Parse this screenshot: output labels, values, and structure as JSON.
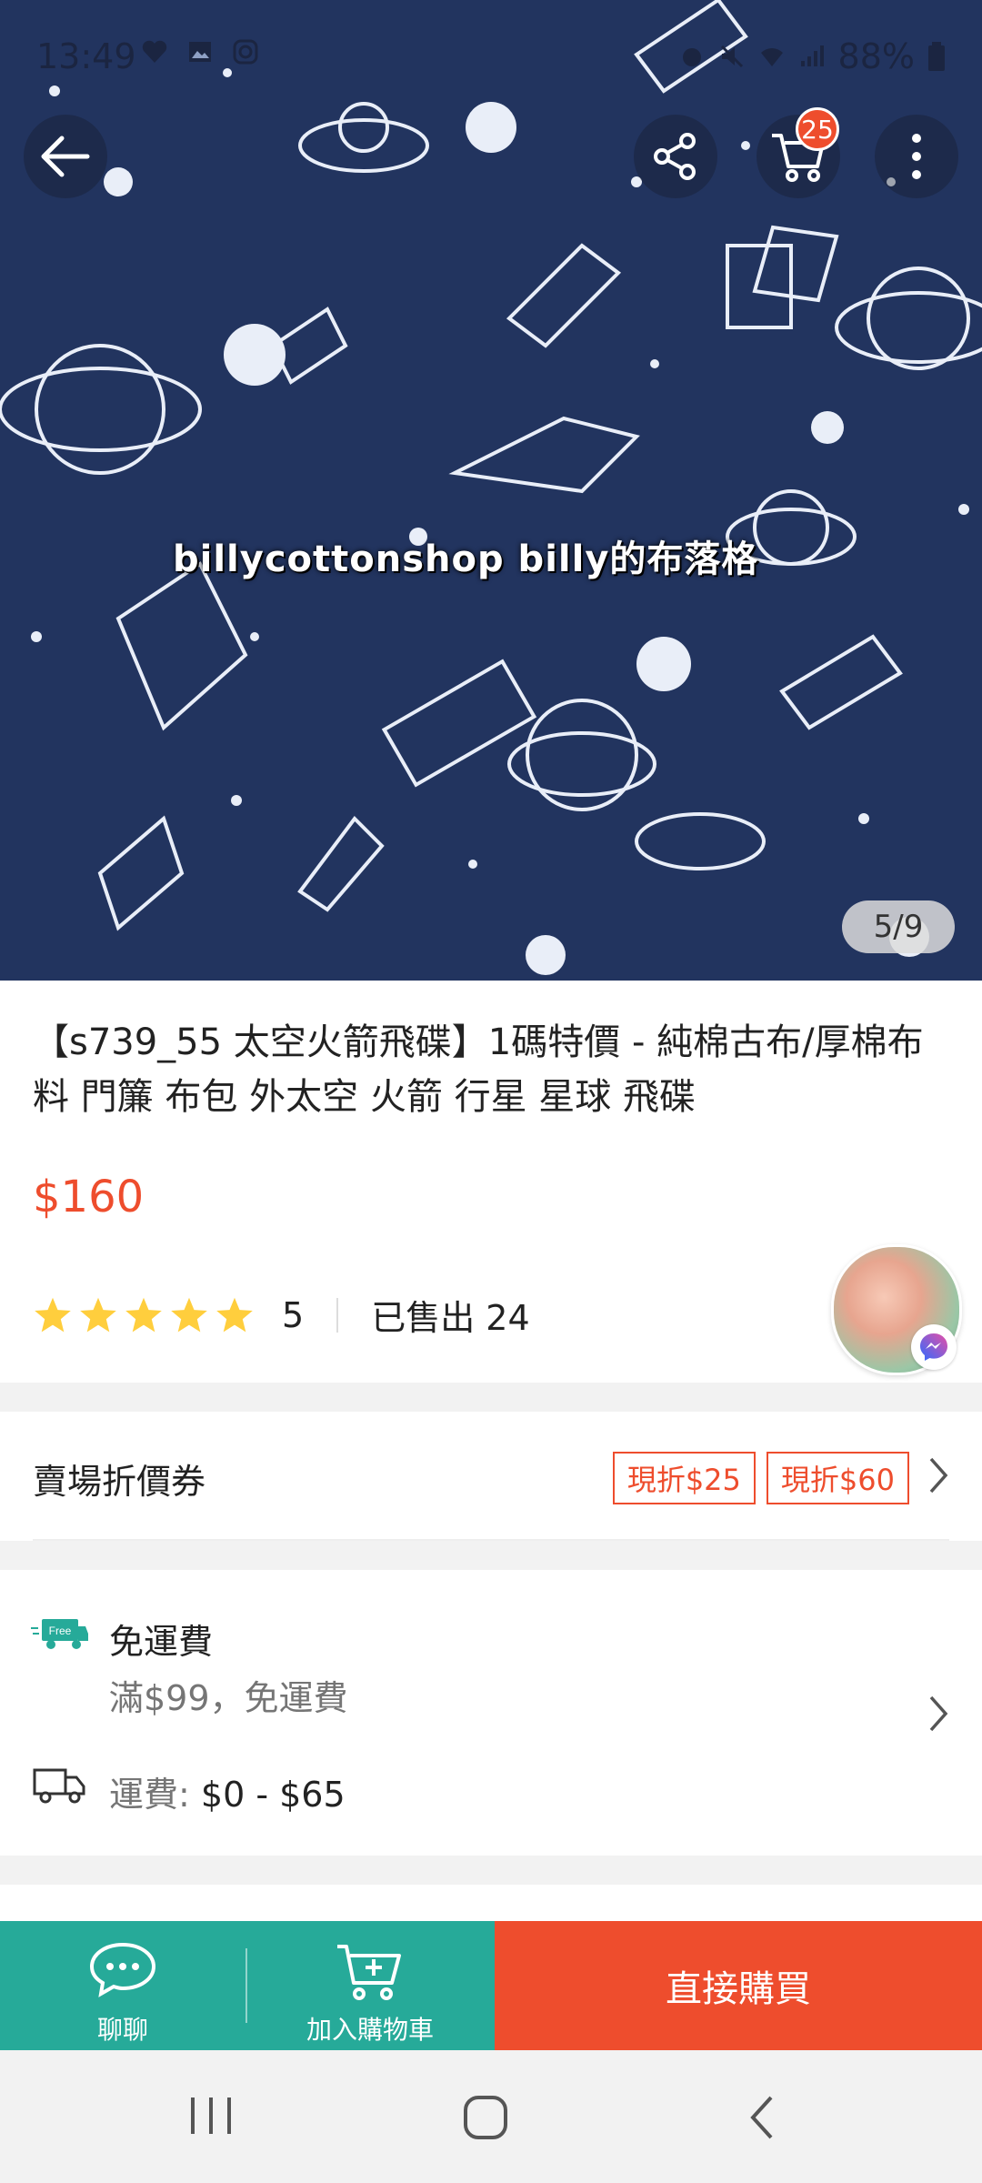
{
  "status_bar": {
    "time": "13:49",
    "battery": "88%"
  },
  "hero": {
    "cart_count": "25",
    "watermark": "billycottonshop billy的布落格",
    "image_counter": "5/9"
  },
  "product": {
    "title": "【s739_55 太空火箭飛碟】1碼特價 - 純棉古布/厚棉布料 門簾 布包 外太空 火箭 行星 星球 飛碟",
    "price": "$160",
    "rating": "5",
    "sold": "已售出 24"
  },
  "voucher": {
    "label": "賣場折價券",
    "tags": [
      "現折$25",
      "現折$60"
    ]
  },
  "shipping": {
    "free_badge": "Free",
    "title": "免運費",
    "condition": "滿$99，免運費",
    "fee_label": "運費: ",
    "fee_value": "$0 - $65"
  },
  "bottom_bar": {
    "chat": "聊聊",
    "add_to_cart": "加入購物車",
    "buy_now": "直接購買"
  },
  "colors": {
    "brand": "#ee4d2d",
    "teal": "#26aa99",
    "star": "#ffce3d"
  }
}
